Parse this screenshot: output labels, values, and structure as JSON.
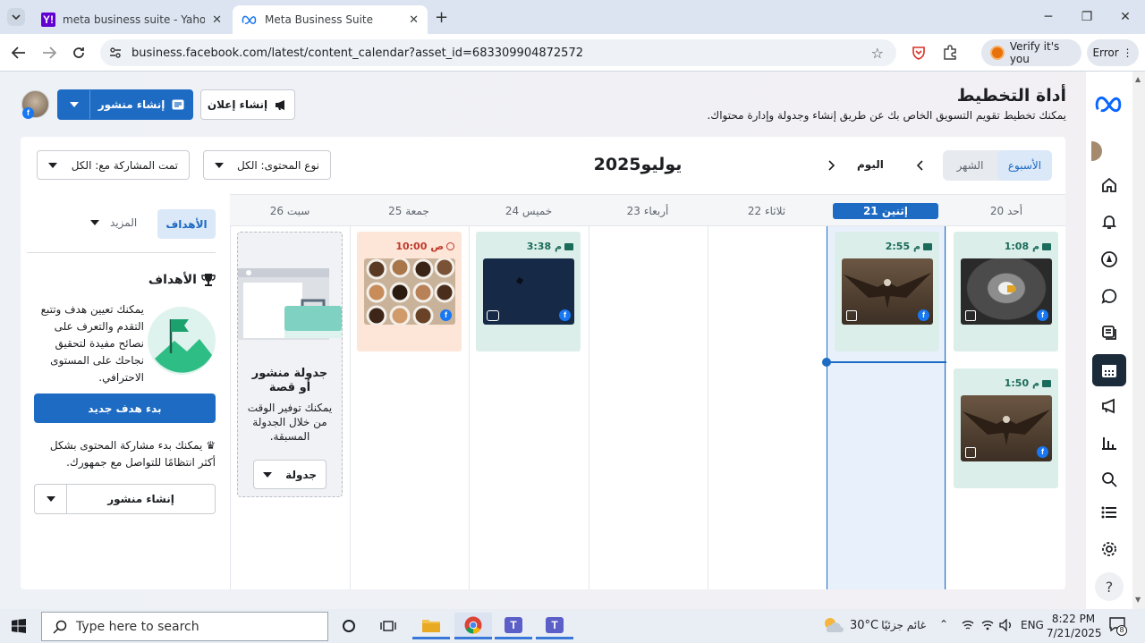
{
  "browser": {
    "tabs": [
      {
        "title": "meta business suite - Yahoo Se",
        "active": false
      },
      {
        "title": "Meta Business Suite",
        "active": true
      }
    ],
    "url": "business.facebook.com/latest/content_calendar?asset_id=683309904872572",
    "verify_label": "Verify it's you",
    "error_label": "Error"
  },
  "header": {
    "title": "أداة التخطيط",
    "subtitle": "يمكنك تخطيط تقويم التسويق الخاص بك عن طريق إنشاء وجدولة وإدارة محتواك.",
    "create_post_label": "إنشاء منشور",
    "create_ad_label": "إنشاء إعلان"
  },
  "toolbar": {
    "view_week": "الأسبوع",
    "view_month": "الشهر",
    "today": "اليوم",
    "month_title": "يوليو2025",
    "content_type_filter": "نوع المحتوى: الكل",
    "shared_with_filter": "تمت المشاركة مع: الكل"
  },
  "calendar": {
    "days": [
      {
        "label": "أحد 20",
        "today": false
      },
      {
        "label": "إثنين 21",
        "today": true
      },
      {
        "label": "ثلاثاء 22",
        "today": false
      },
      {
        "label": "أربعاء 23",
        "today": false
      },
      {
        "label": "خميس 24",
        "today": false
      },
      {
        "label": "جمعة 25",
        "today": false
      },
      {
        "label": "سبت 26",
        "today": false
      }
    ],
    "posts": [
      {
        "time": "1:08 م",
        "image": "eagle-portrait"
      },
      {
        "time": "1:50 م",
        "image": "eagle-flying"
      },
      {
        "time": "2:55 م",
        "image": "eagle-flying"
      },
      {
        "time": "3:38 م",
        "image": "dark-sky-reel"
      },
      {
        "time": "10:00 ص",
        "image": "coffee-cups",
        "status": "draft"
      }
    ],
    "empty_promo": {
      "title": "جدولة منشور أو قصة",
      "text": "يمكنك توفير الوقت من خلال الجدولة المسبقة.",
      "button": "جدولة"
    }
  },
  "sidebar": {
    "tabs": {
      "goals": "الأهداف",
      "more": "المزيد"
    },
    "goals_title": "الأهداف",
    "goals_text": "يمكنك تعيين هدف وتتبع التقدم والتعرف على نصائح مفيدة لتحقيق نجاحك على المستوى الاحترافي.",
    "new_goal_button": "بدء هدف جديد",
    "share_text": "يمكنك بدء مشاركة المحتوى بشكل أكثر انتظامًا للتواصل مع جمهورك.",
    "create_post_button": "إنشاء منشور"
  },
  "taskbar": {
    "search_placeholder": "Type here to search",
    "weather": "30°C",
    "weather_label": "غائم جزئيًا",
    "language": "ENG",
    "time": "8:22 PM",
    "date": "7/21/2025",
    "notification_count": "8"
  },
  "colors": {
    "accent": "#1e6bc4",
    "post_bg": "#dceeea",
    "draft_bg": "#fde6d8",
    "today_col": "#e8f1fb"
  }
}
